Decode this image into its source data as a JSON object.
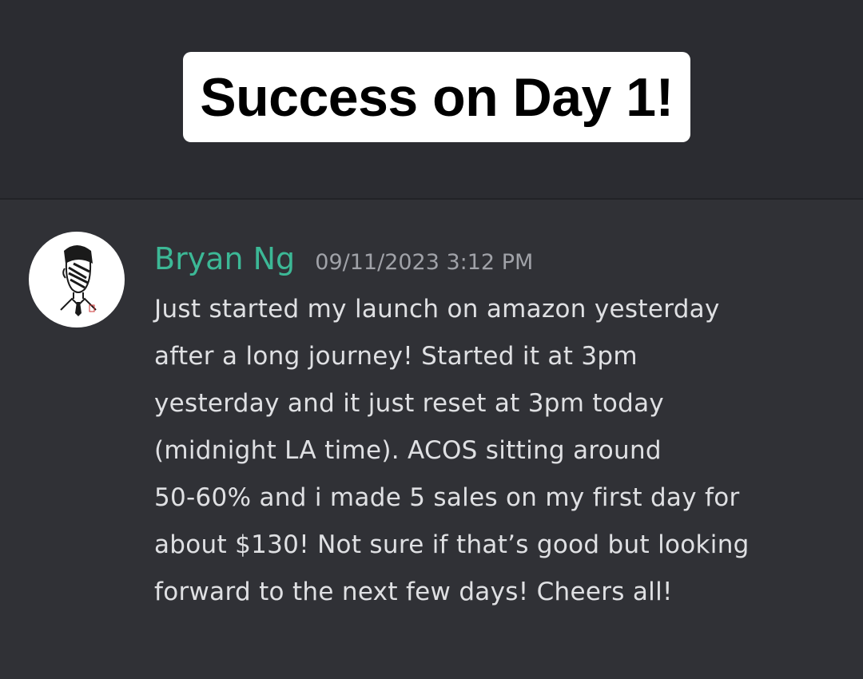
{
  "banner": {
    "title": "Success on Day 1!"
  },
  "message": {
    "author": "Bryan Ng",
    "timestamp": "09/11/2023 3:12 PM",
    "avatar_icon": "sketch-portrait-avatar",
    "lines": [
      "Just started my launch on amazon yesterday",
      "after a long journey! Started it at 3pm",
      "yesterday and it just reset at 3pm today",
      "(midnight LA time). ACOS sitting around",
      "50-60% and i made 5 sales on my first day for",
      "about $130! Not sure if that’s good but looking",
      "forward to the next few days! Cheers all!"
    ]
  },
  "colors": {
    "background": "#303136",
    "header_band": "#2b2c31",
    "username": "#3cb896",
    "timestamp": "#a0a2a8",
    "body_text": "#dfe0e3"
  }
}
